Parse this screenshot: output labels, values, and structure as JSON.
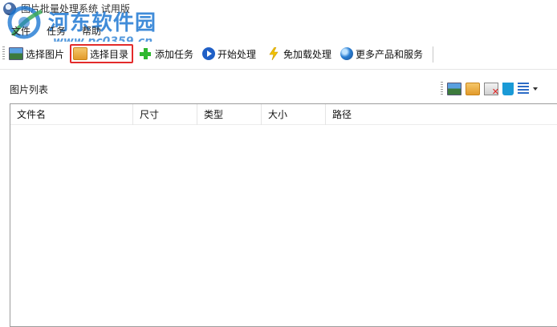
{
  "window": {
    "title": "图片批量处理系统 试用版"
  },
  "watermark": {
    "site_name": "河东软件园",
    "url": "www.pc0359.cn"
  },
  "menu": {
    "file": "文件",
    "task": "任务",
    "help": "帮助"
  },
  "toolbar": {
    "select_images": "选择图片",
    "select_directory": "选择目录",
    "add_task": "添加任务",
    "start_processing": "开始处理",
    "no_load_processing": "免加载处理",
    "more_products": "更多产品和服务"
  },
  "panel": {
    "title": "图片列表"
  },
  "list": {
    "columns": [
      "文件名",
      "尺寸",
      "类型",
      "大小",
      "路径"
    ]
  },
  "colors": {
    "highlight": "#e32b2b",
    "watermark": "#1e78d2"
  }
}
